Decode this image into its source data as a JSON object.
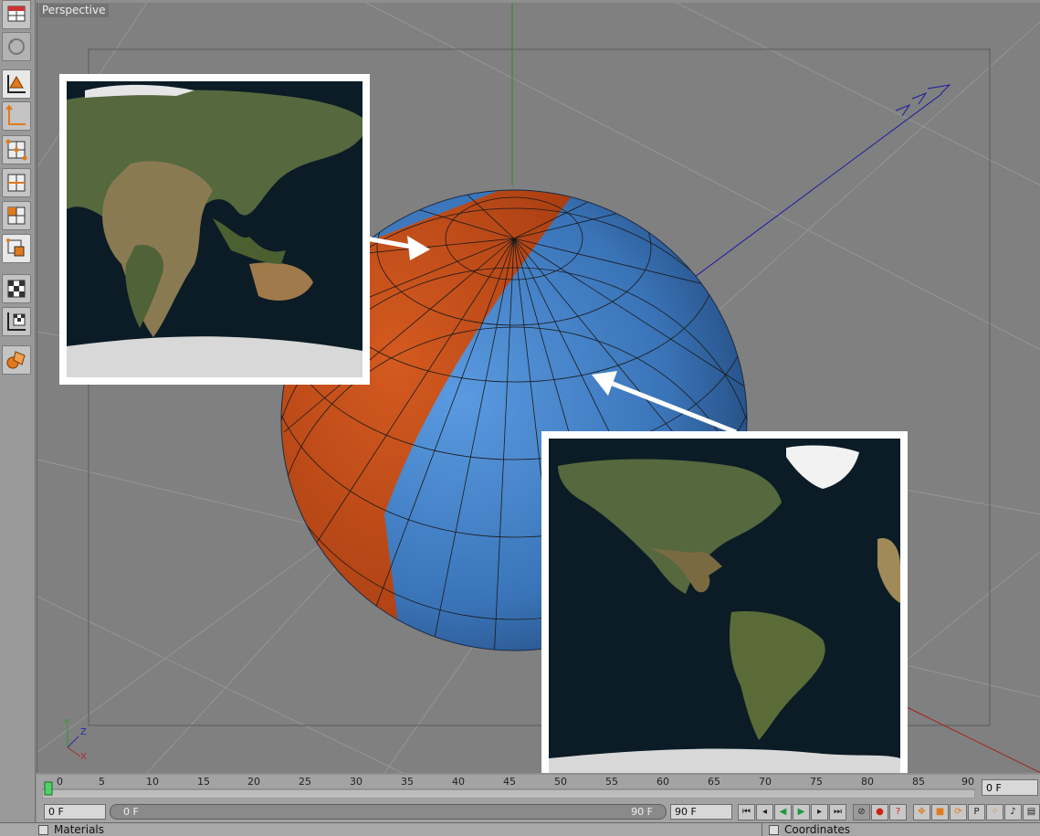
{
  "viewport": {
    "label": "Perspective"
  },
  "toolbar": {
    "buttons": [
      "layout-icon",
      "undo-view-icon",
      "model-tool-icon",
      "object-axis-icon",
      "point-mode-icon",
      "edge-mode-icon",
      "polygon-mode-icon",
      "uv-points-icon",
      "texture-mode-icon",
      "texture-axis-icon",
      "workplane-icon"
    ]
  },
  "timeline": {
    "ticks": [
      "0",
      "5",
      "10",
      "15",
      "20",
      "25",
      "30",
      "35",
      "40",
      "45",
      "50",
      "55",
      "60",
      "65",
      "70",
      "75",
      "80",
      "85",
      "90"
    ],
    "current_frame_field": "0 F"
  },
  "controls": {
    "start_field": "0 F",
    "slider_start": "0 F",
    "slider_end": "90 F",
    "end_field": "90 F"
  },
  "panels": {
    "materials": "Materials",
    "coordinates": "Coordinates"
  },
  "colors": {
    "sphere_orange": "#c2461a",
    "sphere_blue": "#3f7ec4",
    "viewport_bg": "#808080"
  }
}
